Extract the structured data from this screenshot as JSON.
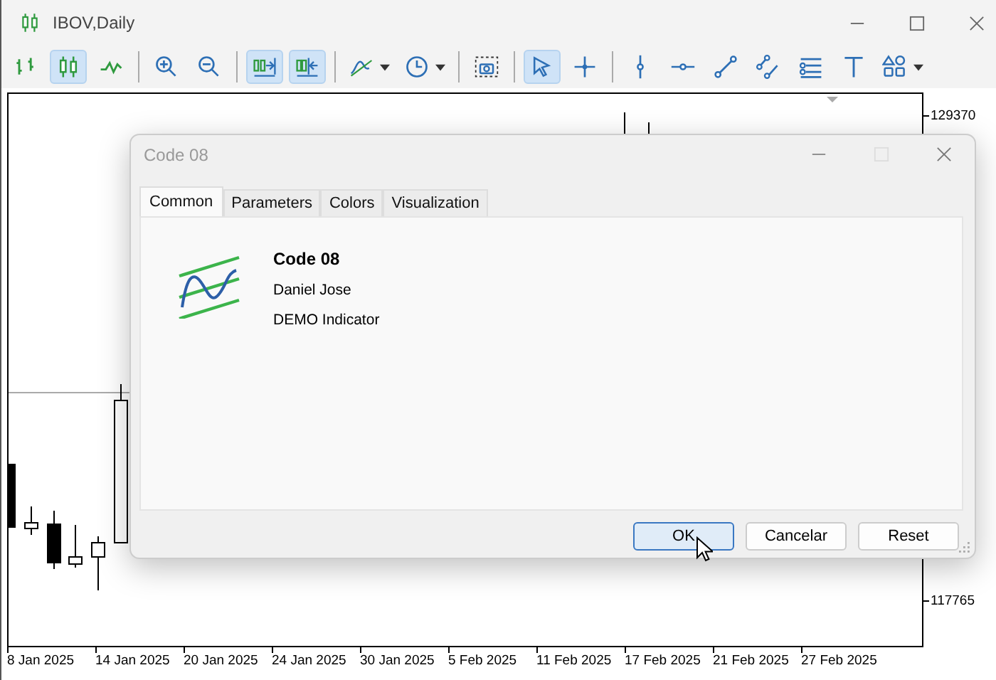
{
  "window": {
    "title": "IBOV,Daily"
  },
  "toolbar": [
    [
      {
        "selected": false,
        "dropdown": false
      },
      {
        "selected": true,
        "dropdown": false
      },
      {
        "selected": false,
        "dropdown": false
      }
    ],
    [
      {
        "selected": false,
        "dropdown": false
      },
      {
        "selected": false,
        "dropdown": false
      }
    ],
    [
      {
        "selected": true,
        "dropdown": false
      },
      {
        "selected": true,
        "dropdown": false
      }
    ],
    [
      {
        "selected": false,
        "dropdown": true
      },
      {
        "selected": false,
        "dropdown": true
      }
    ],
    [
      {
        "selected": false,
        "dropdown": false
      }
    ],
    [
      {
        "selected": true,
        "dropdown": false
      },
      {
        "selected": false,
        "dropdown": false
      }
    ],
    [
      {
        "selected": false,
        "dropdown": false
      },
      {
        "selected": false,
        "dropdown": false
      },
      {
        "selected": false,
        "dropdown": false
      },
      {
        "selected": false,
        "dropdown": false
      },
      {
        "selected": false,
        "dropdown": false
      },
      {
        "selected": false,
        "dropdown": false
      },
      {
        "selected": false,
        "dropdown": true
      }
    ]
  ],
  "chart": {
    "price_labels": [
      "129370",
      "117765"
    ],
    "date_labels": [
      "8 Jan 2025",
      "14 Jan 2025",
      "20 Jan 2025",
      "24 Jan 2025",
      "30 Jan 2025",
      "5 Feb 2025",
      "11 Feb 2025",
      "17 Feb 2025",
      "21 Feb 2025",
      "27 Feb 2025"
    ]
  },
  "dialog": {
    "title": "Code 08",
    "tabs": [
      {
        "label": "Common",
        "selected": true
      },
      {
        "label": "Parameters",
        "selected": false
      },
      {
        "label": "Colors",
        "selected": false
      },
      {
        "label": "Visualization",
        "selected": false
      }
    ],
    "indicator": {
      "name": "Code 08",
      "author": "Daniel Jose",
      "description": "DEMO Indicator"
    },
    "buttons": [
      {
        "label": "OK",
        "selected": true
      },
      {
        "label": "Cancelar",
        "selected": false
      },
      {
        "label": "Reset",
        "selected": false
      }
    ]
  }
}
